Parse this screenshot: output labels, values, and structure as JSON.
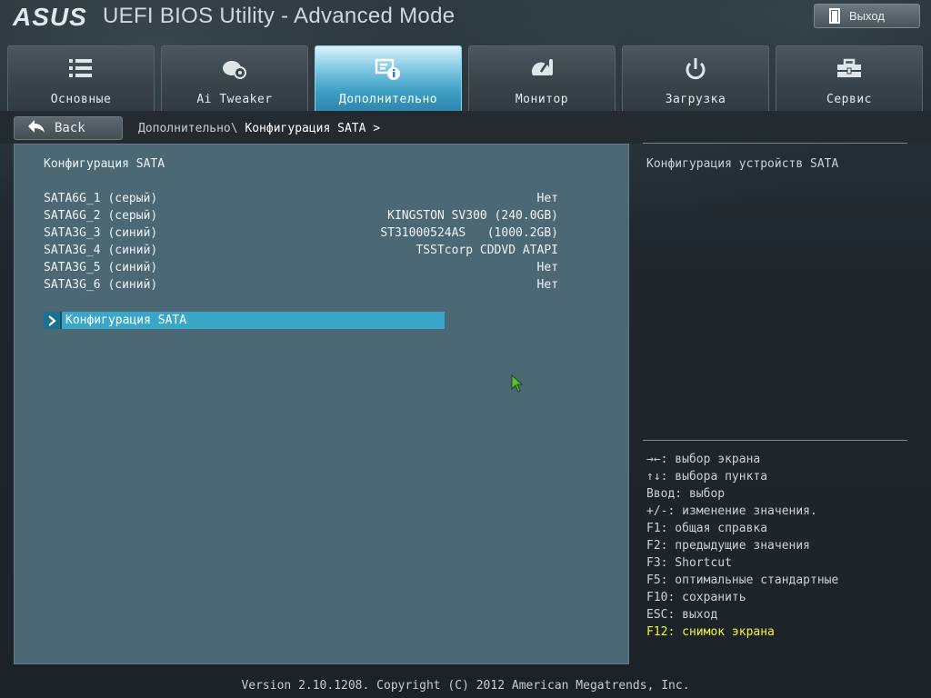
{
  "header": {
    "logo": "ASUS",
    "title": "UEFI BIOS Utility - Advanced Mode",
    "exit_label": "Выход"
  },
  "tabs": [
    {
      "label": "Основные",
      "icon": "list-icon"
    },
    {
      "label": "Ai Tweaker",
      "icon": "ai-tweaker-icon"
    },
    {
      "label": "Дополнительно",
      "icon": "advanced-icon",
      "active": true
    },
    {
      "label": "Монитор",
      "icon": "monitor-gauge-icon"
    },
    {
      "label": "Загрузка",
      "icon": "power-icon"
    },
    {
      "label": "Сервис",
      "icon": "toolbox-icon"
    }
  ],
  "nav": {
    "back_label": "Back",
    "breadcrumb_path": "Дополнительно\\ ",
    "breadcrumb_current": "Конфигурация SATA >"
  },
  "main": {
    "section_title": "Конфигурация SATA",
    "ports": [
      {
        "label": "SATA6G_1 (серый)",
        "value": "Нет"
      },
      {
        "label": "SATA6G_2 (серый)",
        "value": "KINGSTON SV300 (240.0GB)"
      },
      {
        "label": "SATA3G_3 (синий)",
        "value": "ST31000524AS   (1000.2GB)"
      },
      {
        "label": "SATA3G_4 (синий)",
        "value": "TSSTcorp CDDVD ATAPI"
      },
      {
        "label": "SATA3G_5 (синий)",
        "value": "Нет"
      },
      {
        "label": "SATA3G_6 (синий)",
        "value": "Нет"
      }
    ],
    "submenu_label": "Конфигурация SATA"
  },
  "help": {
    "description": "Конфигурация устройств SATA",
    "keys": [
      "→←: выбор экрана",
      "↑↓: выбора пункта",
      "Ввод: выбор",
      "+/-: изменение значения.",
      "F1: общая справка",
      "F2: предыдущие значения",
      "F3: Shortcut",
      "F5: оптимальные стандартные",
      "F10: сохранить",
      "ESC: выход"
    ],
    "highlight_key": "F12: снимок экрана"
  },
  "footer": {
    "text": "Version 2.10.1208. Copyright (C) 2012 American Megatrends, Inc."
  },
  "colors": {
    "active_tab": "#3d9fc4",
    "panel": "#4b6874",
    "selection": "#3aa7c8",
    "highlight_text": "#f4f23c"
  }
}
